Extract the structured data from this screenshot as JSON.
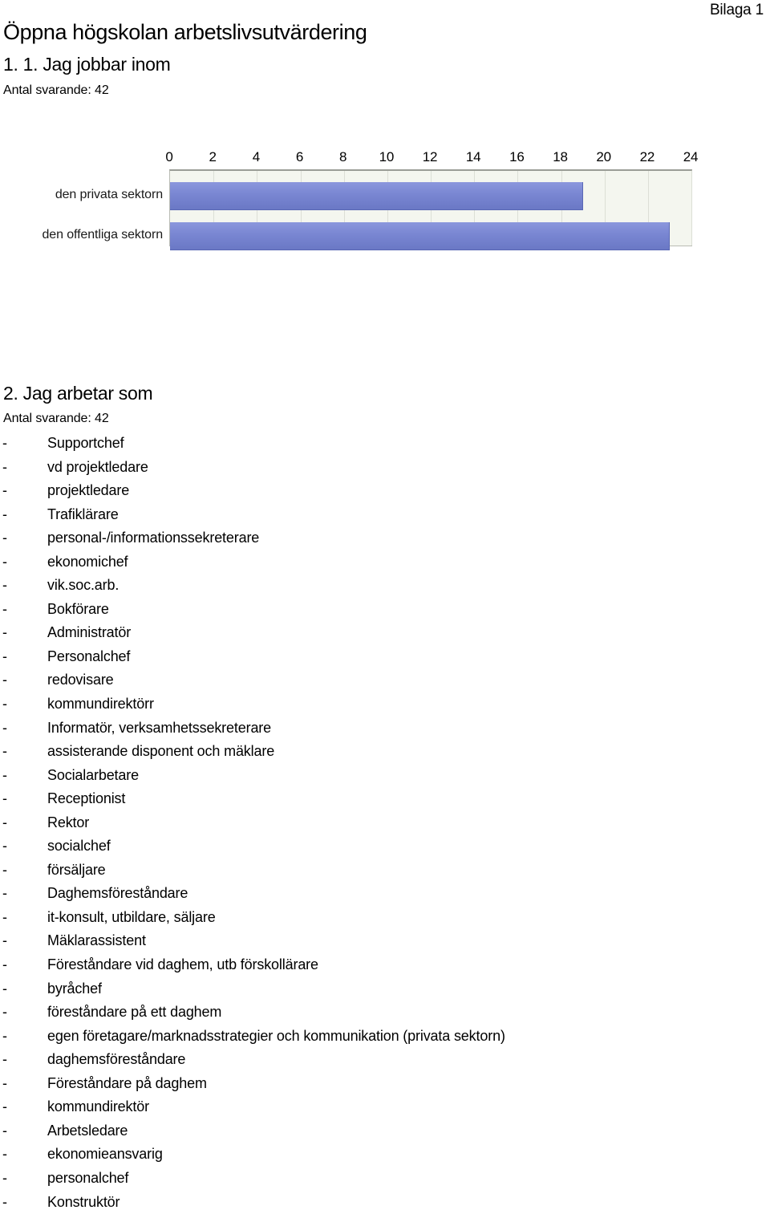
{
  "header": {
    "appendix_label": "Bilaga 1"
  },
  "document": {
    "title": "Öppna högskolan arbetslivsutvärdering"
  },
  "question1": {
    "title": "1. 1. Jag jobbar inom",
    "respondents_label": "Antal svarande: 42"
  },
  "chart_data": {
    "type": "bar",
    "orientation": "horizontal",
    "title": "1. 1. Jag jobbar inom",
    "categories": [
      "den privata sektorn",
      "den offentliga sektorn"
    ],
    "values": [
      19,
      23
    ],
    "xlabel": "",
    "ylabel": "",
    "xlim": [
      0,
      24
    ],
    "xticks": [
      0,
      2,
      4,
      6,
      8,
      10,
      12,
      14,
      16,
      18,
      20,
      22,
      24
    ],
    "xtick_labels": [
      "0",
      "2",
      "4",
      "6",
      "8",
      "10",
      "12",
      "14",
      "16",
      "18",
      "20",
      "22",
      "24"
    ],
    "grid": true,
    "legend": false,
    "bar_color": "#7986d2",
    "plot_background": "#f4f6ef",
    "gridline_color": "#dcdfd6"
  },
  "question2": {
    "title": "2. Jag arbetar som",
    "respondents_label": "Antal svarande: 42",
    "bullet": "-",
    "answers": [
      "Supportchef",
      "vd projektledare",
      "projektledare",
      "Trafiklärare",
      "personal-/informationssekreterare",
      "ekonomichef",
      "vik.soc.arb.",
      "Bokförare",
      "Administratör",
      "Personalchef",
      "redovisare",
      "kommundirektörr",
      "Informatör, verksamhetssekreterare",
      "assisterande disponent och mäklare",
      "Socialarbetare",
      "Receptionist",
      "Rektor",
      "socialchef",
      "försäljare",
      "Daghemsföreståndare",
      "it-konsult, utbildare, säljare",
      "Mäklarassistent",
      "Föreståndare vid daghem, utb förskollärare",
      "byråchef",
      "föreståndare på ett daghem",
      "egen företagare/marknadsstrategier och kommunikation (privata sektorn)",
      "daghemsföreståndare",
      "Föreståndare på daghem",
      "kommundirektör",
      "Arbetsledare",
      "ekonomieansvarig",
      "personalchef",
      "Konstruktör"
    ]
  }
}
